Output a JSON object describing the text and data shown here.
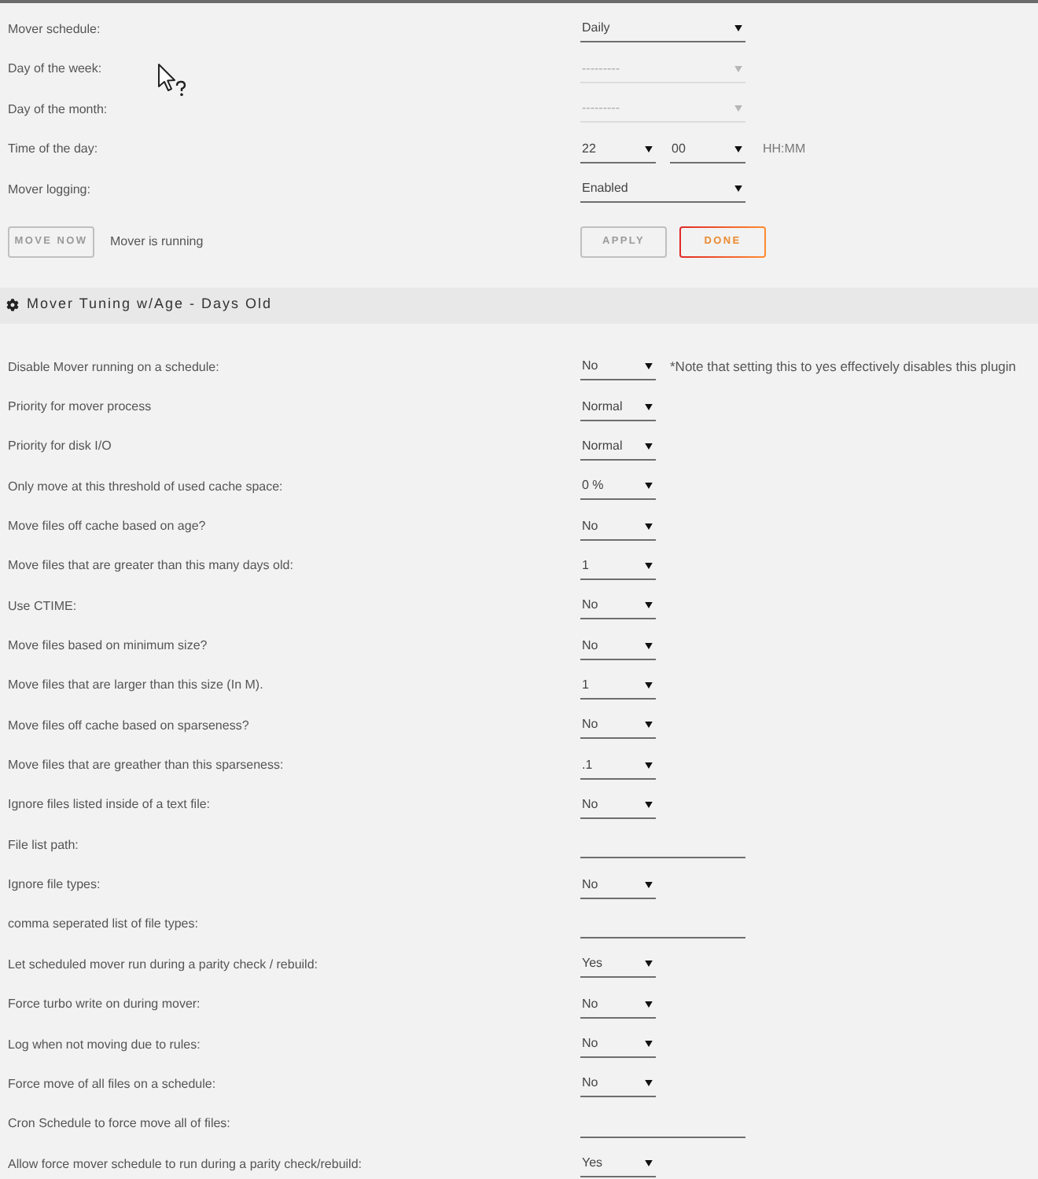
{
  "schedule": {
    "rows": [
      {
        "label": "Mover schedule:",
        "kind": "select",
        "value": "Daily",
        "disabled": false
      },
      {
        "label": "Day of the week:",
        "kind": "select",
        "value": "---------",
        "disabled": true
      },
      {
        "label": "Day of the month:",
        "kind": "select",
        "value": "---------",
        "disabled": true
      },
      {
        "label": "Time of the day:",
        "kind": "time",
        "hour": "22",
        "minute": "00",
        "hint": "HH:MM",
        "disabled": false
      },
      {
        "label": "Mover logging:",
        "kind": "select",
        "value": "Enabled",
        "disabled": false
      }
    ],
    "move_now": {
      "label": "MOVE NOW",
      "disabled": true
    },
    "status": "Mover is running",
    "buttons": [
      {
        "label": "APPLY",
        "disabled": true
      },
      {
        "label": "DONE",
        "disabled": false
      }
    ]
  },
  "section": {
    "title": "Mover Tuning w/Age - Days Old"
  },
  "settings": [
    {
      "label": "Disable Mover running on a schedule:",
      "kind": "select",
      "value": "No",
      "note": "*Note that setting this to yes effectively disables this plugin"
    },
    {
      "label": "Priority for mover process",
      "kind": "select",
      "value": "Normal"
    },
    {
      "label": "Priority for disk I/O",
      "kind": "select",
      "value": "Normal"
    },
    {
      "label": "Only move at this threshold of used cache space:",
      "kind": "select",
      "value": "0 %"
    },
    {
      "label": "Move files off cache based on age?",
      "kind": "select",
      "value": "No"
    },
    {
      "label": "Move files that are greater than this many days old:",
      "kind": "select",
      "value": "1"
    },
    {
      "label": "Use CTIME:",
      "kind": "select",
      "value": "No"
    },
    {
      "label": "Move files based on minimum size?",
      "kind": "select",
      "value": "No"
    },
    {
      "label": "Move files that are larger than this size (In M).",
      "kind": "select",
      "value": "1"
    },
    {
      "label": "Move files off cache based on sparseness?",
      "kind": "select",
      "value": "No"
    },
    {
      "label": "Move files that are greather than this sparseness:",
      "kind": "select",
      "value": ".1"
    },
    {
      "label": "Ignore files listed inside of a text file:",
      "kind": "select",
      "value": "No"
    },
    {
      "label": "File list path:",
      "kind": "text"
    },
    {
      "label": "Ignore file types:",
      "kind": "select",
      "value": "No"
    },
    {
      "label": "comma seperated list of file types:",
      "kind": "text"
    },
    {
      "label": "Let scheduled mover run during a parity check / rebuild:",
      "kind": "select",
      "value": "Yes"
    },
    {
      "label": "Force turbo write on during mover:",
      "kind": "select",
      "value": "No"
    },
    {
      "label": "Log when not moving due to rules:",
      "kind": "select",
      "value": "No"
    },
    {
      "label": "Force move of all files on a schedule:",
      "kind": "select",
      "value": "No"
    },
    {
      "label": "Cron Schedule to force move all of files:",
      "kind": "text"
    },
    {
      "label": "Allow force mover schedule to run during a parity check/rebuild:",
      "kind": "select",
      "value": "Yes"
    }
  ]
}
